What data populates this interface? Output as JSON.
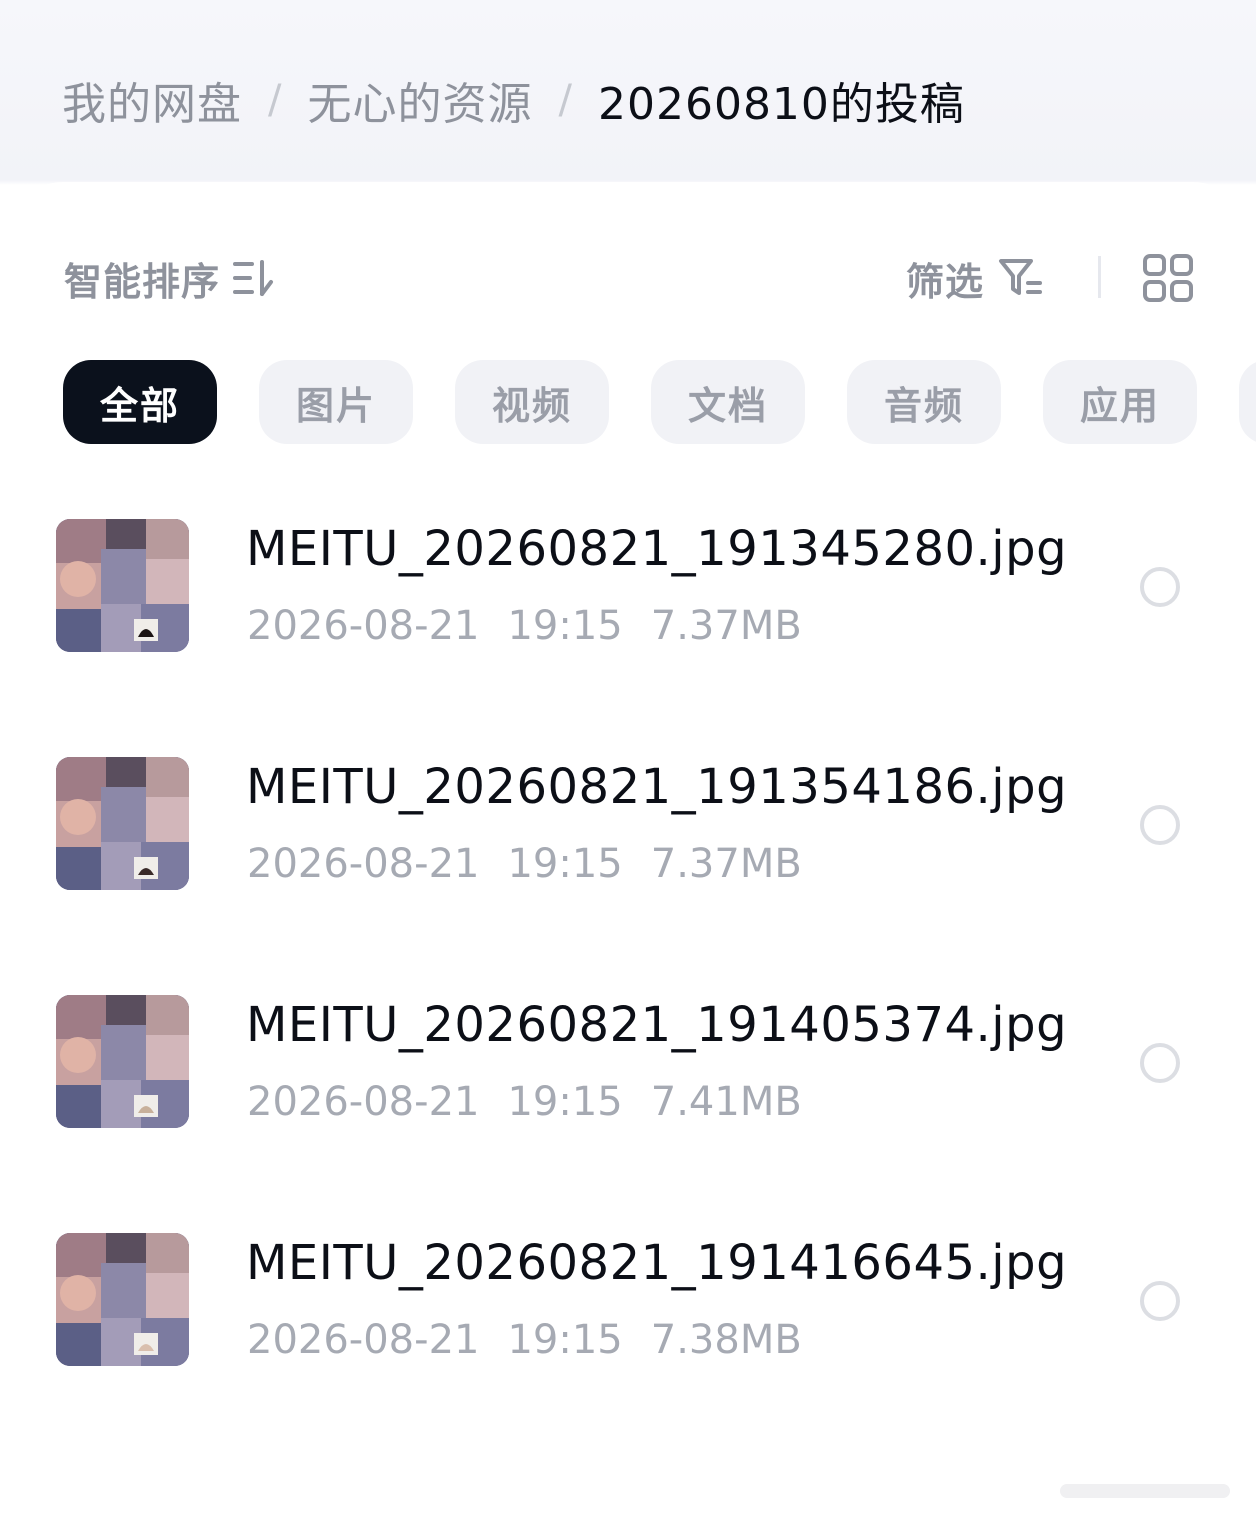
{
  "breadcrumb": {
    "items": [
      "我的网盘",
      "无心的资源",
      "20260810的投稿"
    ],
    "separator": "/"
  },
  "toolbar": {
    "sort_label": "智能排序",
    "sort_icon": "sort-icon",
    "filter_label": "筛选",
    "filter_icon": "filter-icon",
    "view_icon": "grid-view-icon"
  },
  "chips": {
    "items": [
      "全部",
      "图片",
      "视频",
      "文档",
      "音频",
      "应用"
    ],
    "selected": "全部"
  },
  "files": [
    {
      "name": "MEITU_20260821_191345280.jpg",
      "date": "2026-08-21",
      "time": "19:15",
      "size": "7.37MB"
    },
    {
      "name": "MEITU_20260821_191354186.jpg",
      "date": "2026-08-21",
      "time": "19:15",
      "size": "7.37MB"
    },
    {
      "name": "MEITU_20260821_191405374.jpg",
      "date": "2026-08-21",
      "time": "19:15",
      "size": "7.41MB"
    },
    {
      "name": "MEITU_20260821_191416645.jpg",
      "date": "2026-08-21",
      "time": "19:15",
      "size": "7.38MB"
    }
  ],
  "colors": {
    "active_chip_bg": "#0b111c",
    "chip_bg": "#f1f2f6",
    "muted_text": "#8e929c",
    "primary_text": "#0c0f17"
  }
}
